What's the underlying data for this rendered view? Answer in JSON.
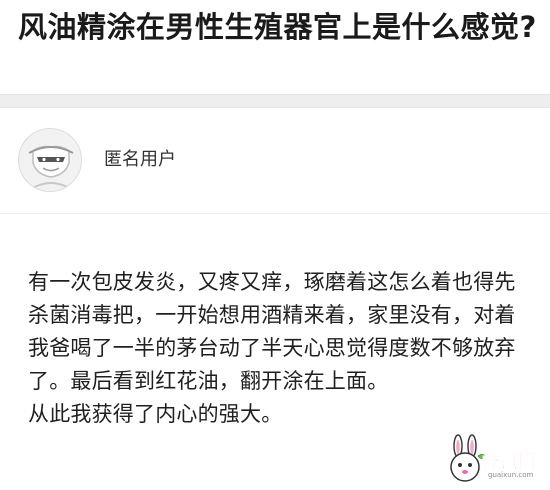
{
  "question": {
    "title": "风油精涂在男性生殖器官上是什么感觉?"
  },
  "answer": {
    "author": {
      "name": "匿名用户",
      "avatar_icon": "anonymous-mask-avatar-icon"
    },
    "paragraphs": [
      "有一次包皮发炎，又疼又痒，琢磨着这怎么着也得先杀菌消毒把，一开始想用酒精来着，家里没有，对着我爸喝了一半的茅台动了半天心思觉得度数不够放弃了。最后看到红花油，翻开涂在上面。",
      "从此我获得了内心的强大。"
    ]
  },
  "watermark": {
    "text": "怪讯网",
    "subtext": "guaixun.com",
    "icon": "rabbit-logo-icon"
  },
  "colors": {
    "divider": "#eeeeee",
    "text": "#1f1f1f",
    "watermark_text": "#e8489a"
  }
}
